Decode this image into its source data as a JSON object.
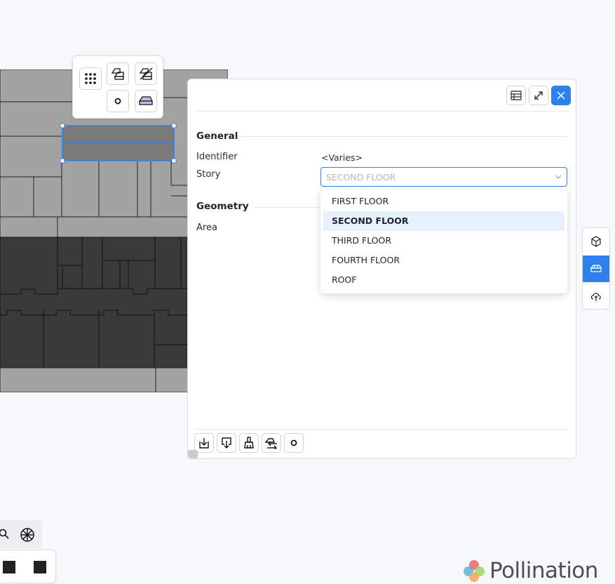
{
  "panel": {
    "general_title": "General",
    "identifier_label": "Identifier",
    "identifier_value": "<Varies>",
    "story_label": "Story",
    "story_selected": "SECOND FLOOR",
    "geometry_title": "Geometry",
    "area_label": "Area"
  },
  "story_options": [
    "FIRST FLOOR",
    "SECOND FLOOR",
    "THIRD FLOOR",
    "FOURTH FLOOR",
    "ROOF"
  ],
  "selected_option_index": 1,
  "logo": {
    "word": "Pollination"
  },
  "colors": {
    "accent": "#2f80ed",
    "selection": "#2f80ed",
    "room_light": "#a3a3a3",
    "room_dark": "#3a3a3a",
    "option_highlight": "#e6f1fd"
  },
  "icons": {
    "tool_popup": [
      "grid-dots-icon",
      "room-stack-icon",
      "room-delete-icon",
      "circle-icon",
      "roof-icon"
    ],
    "panel_header": [
      "table-icon",
      "expand-icon",
      "close-icon"
    ],
    "panel_footer": [
      "import-icon",
      "export-icon",
      "brush-icon",
      "transfer-icon",
      "circle-icon"
    ],
    "right_strip": [
      "cube-icon",
      "room-icon",
      "cloud-upload-icon"
    ],
    "bottom_left": [
      "search-icon",
      "wheel-icon",
      "square-icon",
      "square-icon"
    ]
  }
}
